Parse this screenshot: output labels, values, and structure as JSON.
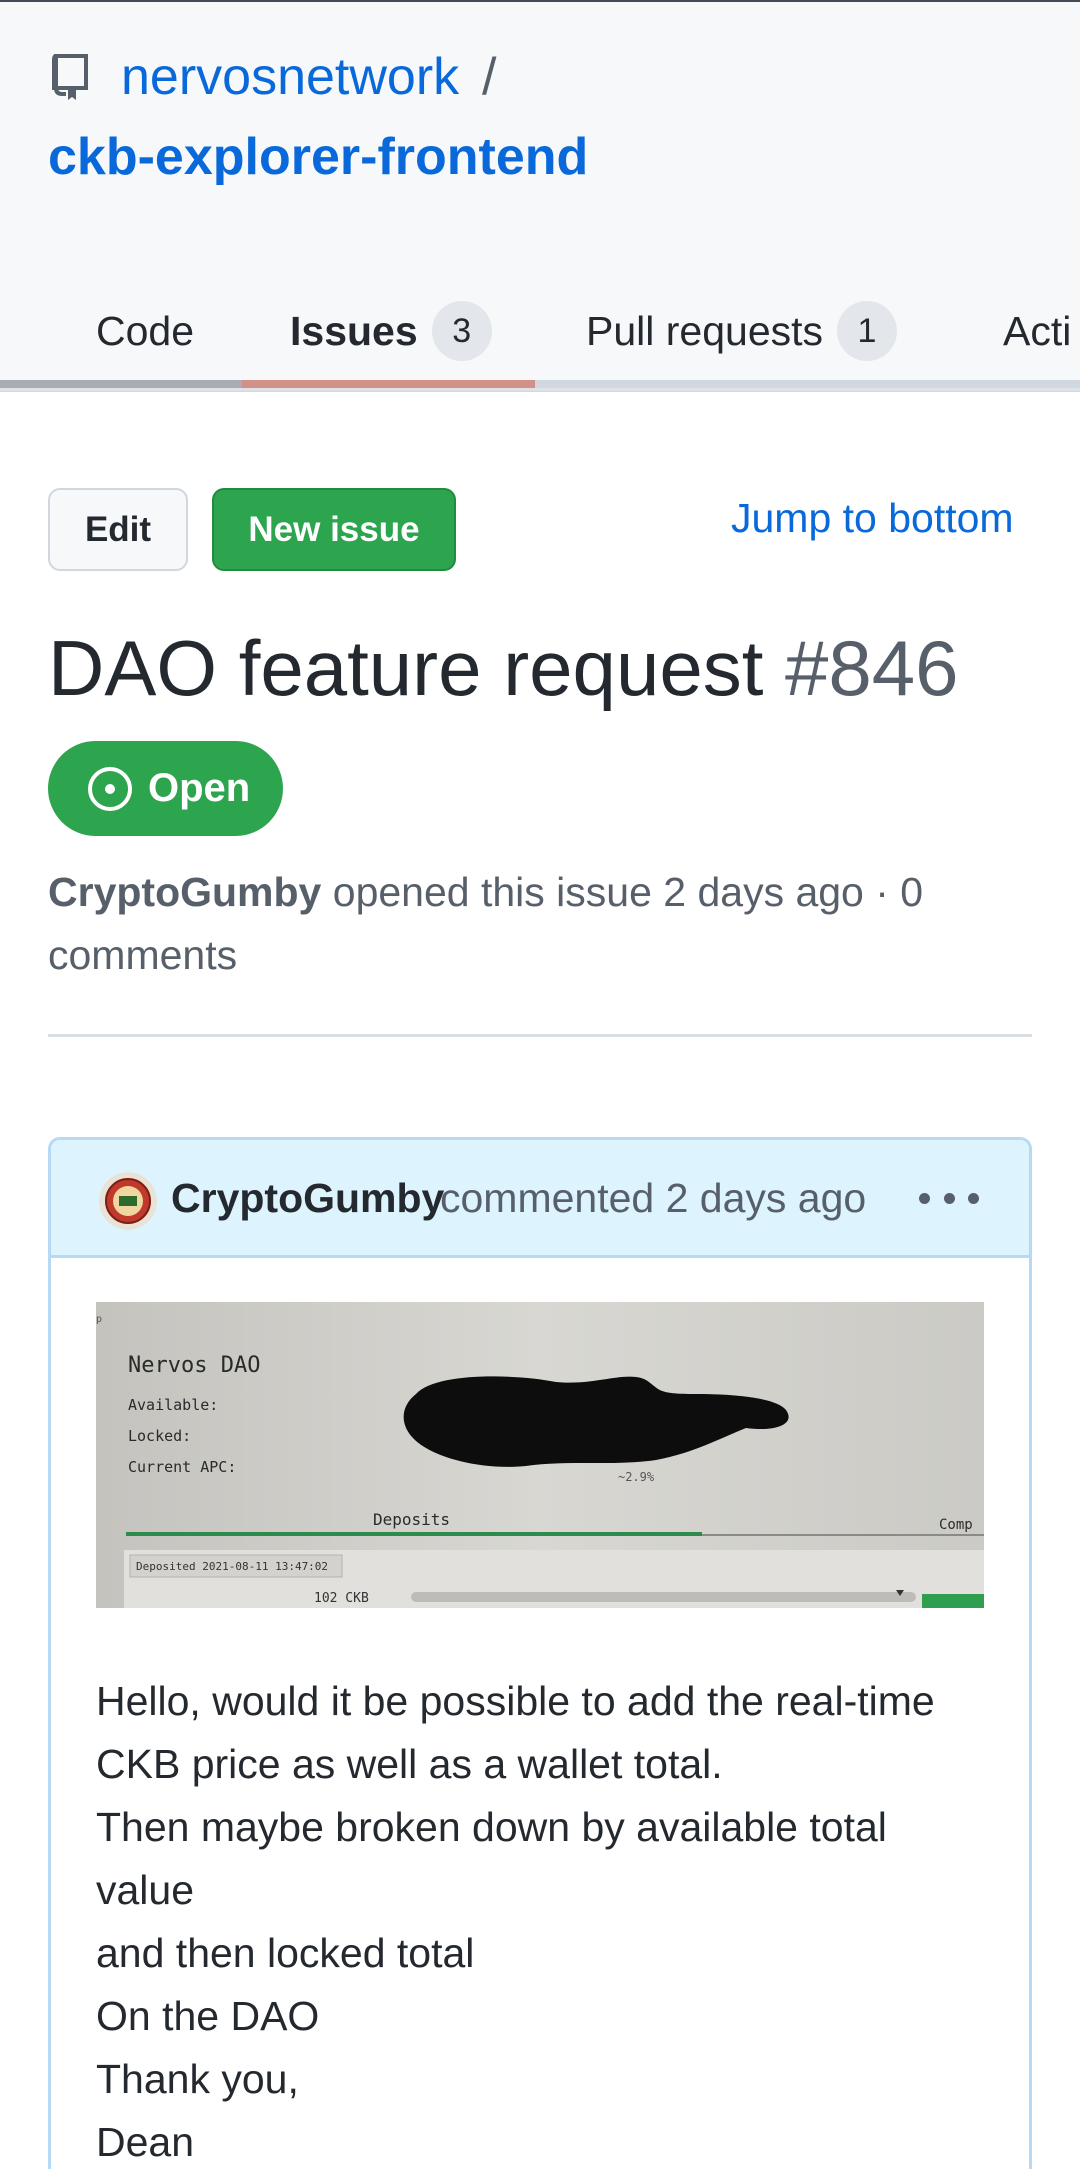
{
  "repo": {
    "owner": "nervosnetwork",
    "separator": "/",
    "name": "ckb-explorer-frontend"
  },
  "tabs": [
    {
      "label": "Code",
      "count": null
    },
    {
      "label": "Issues",
      "count": "3",
      "selected": true
    },
    {
      "label": "Pull requests",
      "count": "1"
    },
    {
      "label": "Acti",
      "count": null
    }
  ],
  "actions": {
    "edit_label": "Edit",
    "new_issue_label": "New issue",
    "jump_label": "Jump to bottom"
  },
  "issue": {
    "title": "DAO feature request",
    "number": "#846",
    "state": "Open",
    "author": "CryptoGumby",
    "meta_line_1": "opened this issue 2 days ago · 0",
    "meta_line_2": "comments"
  },
  "comment": {
    "author": "CryptoGumby",
    "action": "commented 2 days ago",
    "attachment": {
      "heading": "Nervos DAO",
      "rows": [
        "Available:",
        "Locked:",
        "Current APC:"
      ],
      "apc_value": "~2.9%",
      "tab_deposits": "Deposits",
      "tab_other": "Comp",
      "deposit_label": "Deposited 2021-08-11 13:47:02",
      "deposit_amount": "102 CKB",
      "corner_mark": "p"
    },
    "body_lines": [
      "Hello, would it be possible to add the real-time",
      "CKB price as well as a wallet total.",
      "Then maybe broken down by available total",
      "value",
      "and then locked total",
      "On the DAO",
      "Thank you,",
      "Dean"
    ]
  },
  "colors": {
    "link": "#0969da",
    "success": "#2da44e",
    "comment_header_bg": "#ddf4ff",
    "comment_border": "#b6d9f6",
    "muted_text": "#57606a"
  },
  "icons": {
    "repo": "repo-icon",
    "open_state": "issue-opened-icon",
    "menu": "kebab-horizontal-icon"
  }
}
